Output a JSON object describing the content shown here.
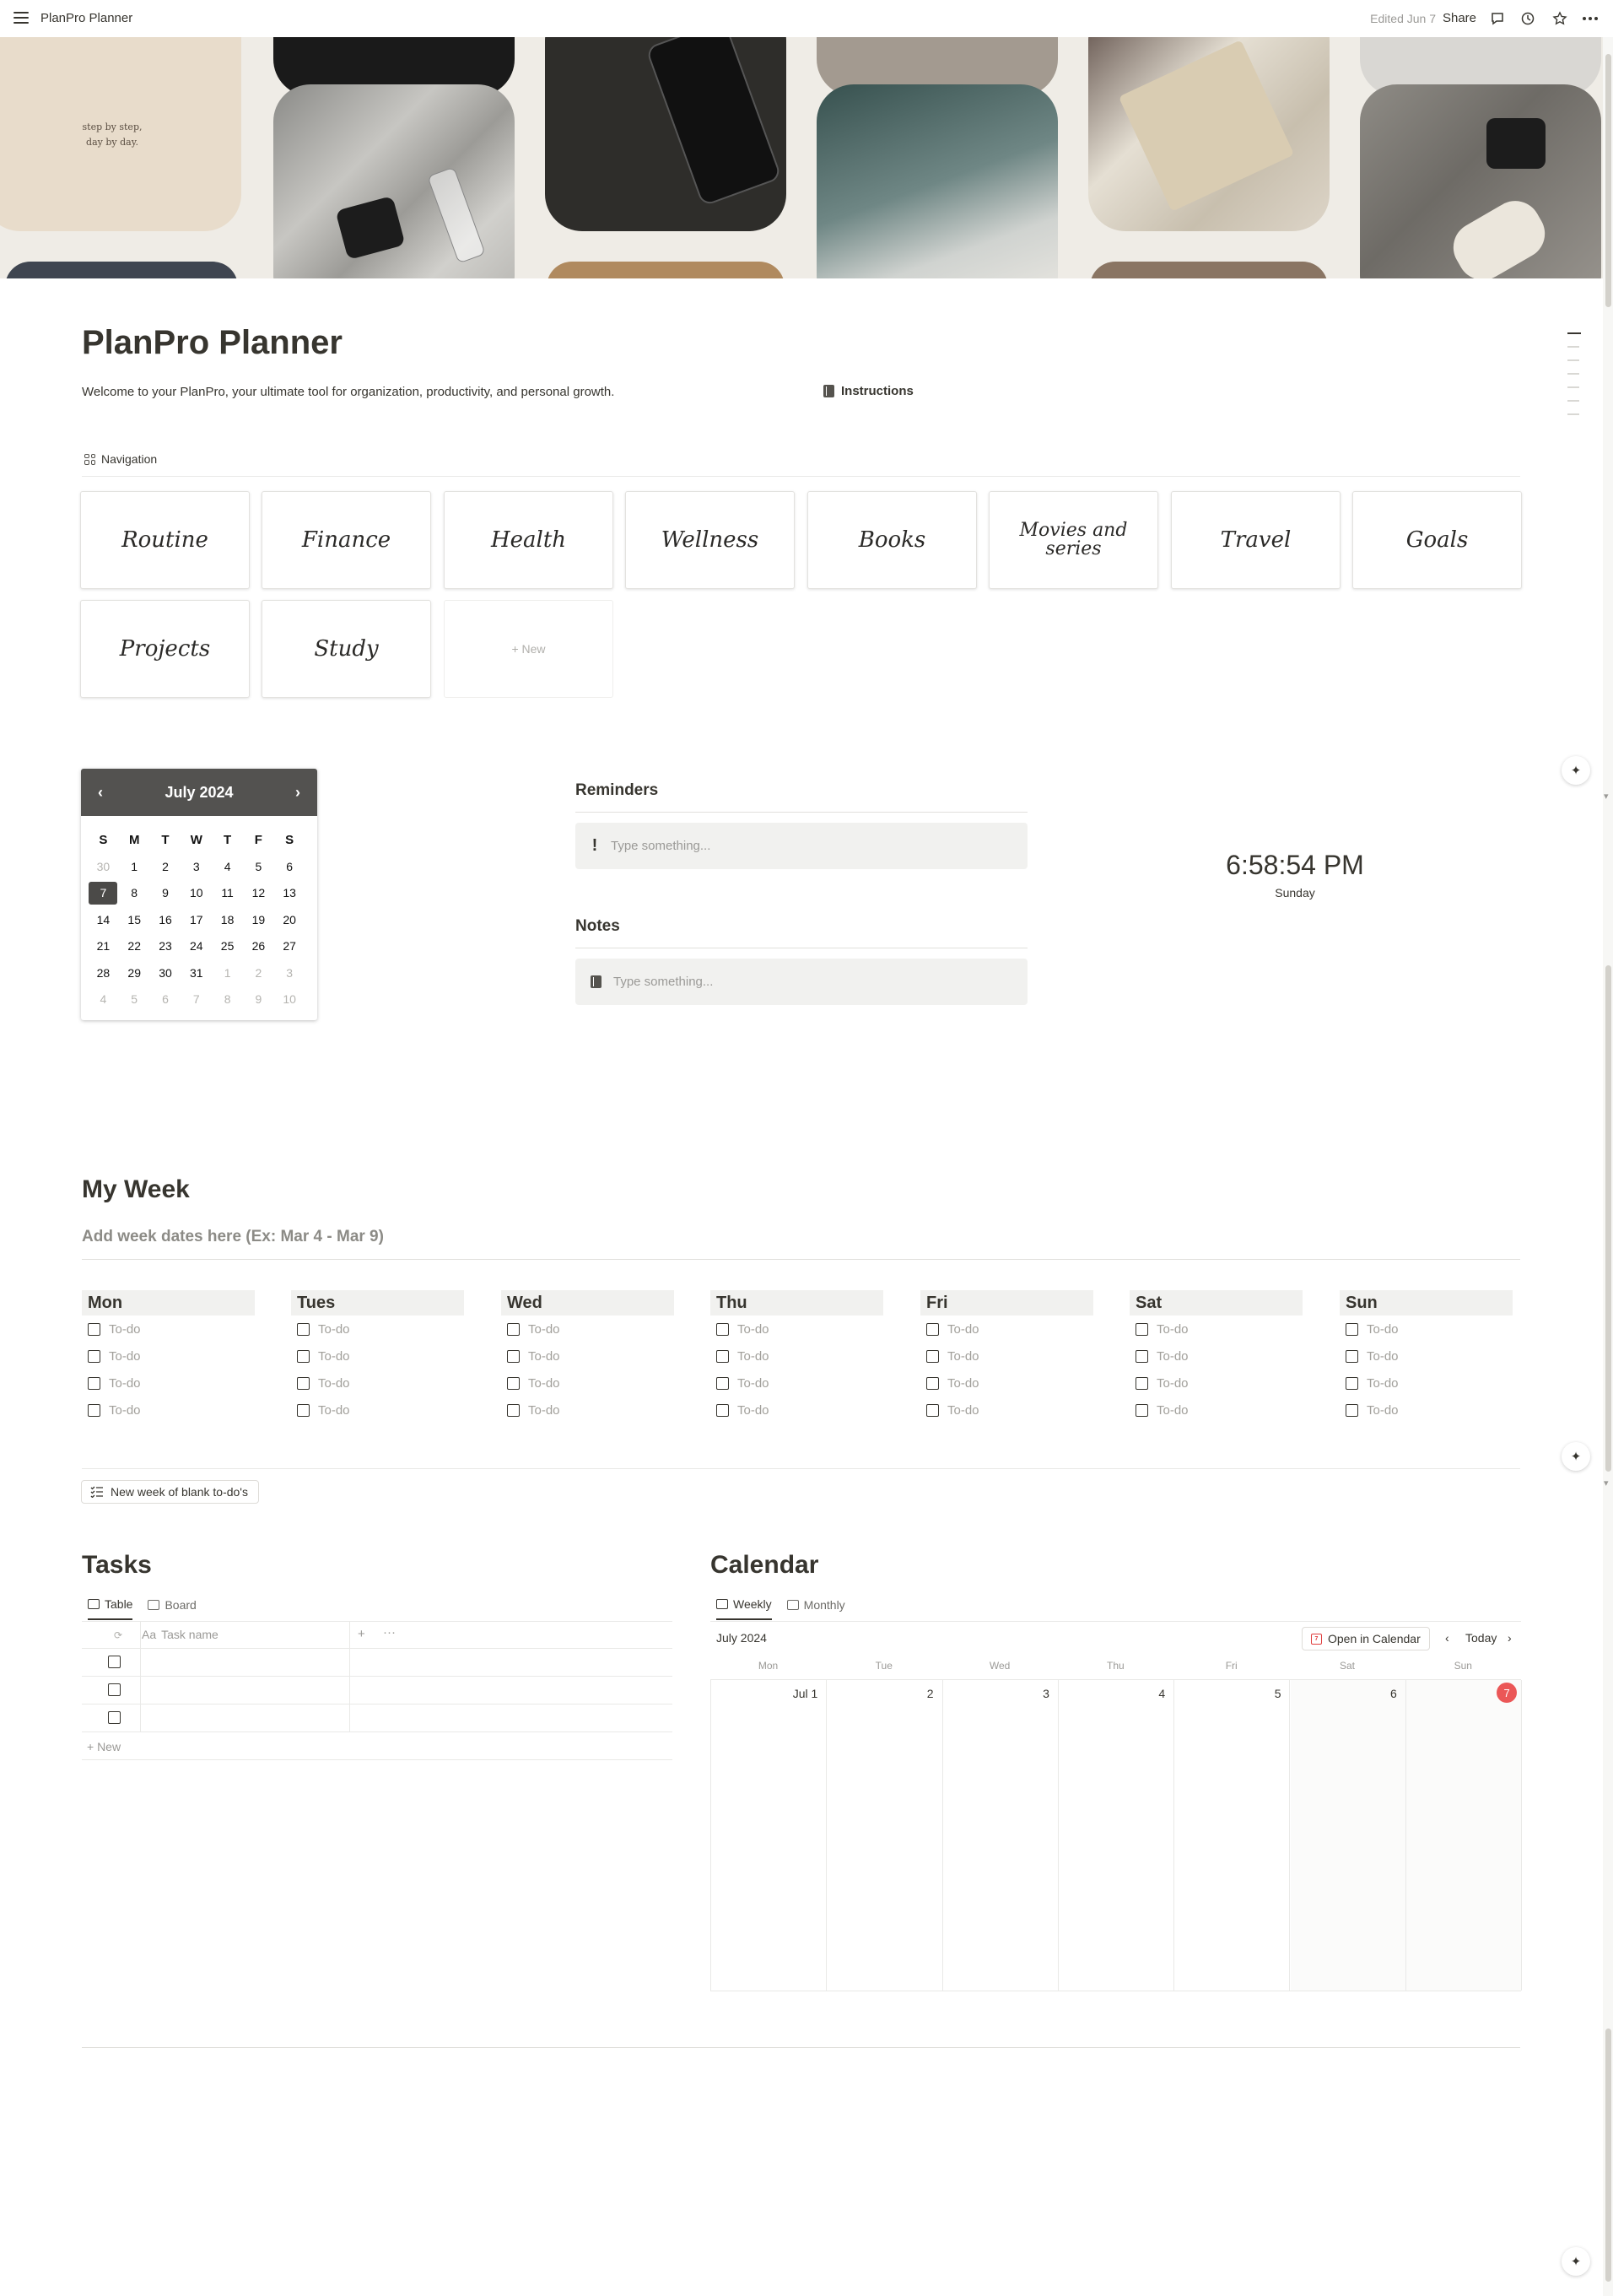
{
  "topbar": {
    "breadcrumb": "PlanPro Planner",
    "edited": "Edited Jun 7",
    "share": "Share"
  },
  "cover": {
    "quote_line1": "step by step,",
    "quote_line2": "day by day."
  },
  "page": {
    "title": "PlanPro Planner",
    "welcome": "Welcome to your PlanPro, your ultimate tool for organization, productivity, and personal growth.",
    "instructions": "Instructions"
  },
  "navigation": {
    "label": "Navigation",
    "cards": [
      "Routine",
      "Finance",
      "Health",
      "Wellness",
      "Books",
      "Movies and series",
      "Travel",
      "Goals",
      "Projects",
      "Study"
    ],
    "new_label": "+ New"
  },
  "mini_calendar": {
    "title": "July 2024",
    "prev": "‹",
    "next": "›",
    "weekdays": [
      "S",
      "M",
      "T",
      "W",
      "T",
      "F",
      "S"
    ],
    "days": [
      "30",
      "1",
      "2",
      "3",
      "4",
      "5",
      "6",
      "7",
      "8",
      "9",
      "10",
      "11",
      "12",
      "13",
      "14",
      "15",
      "16",
      "17",
      "18",
      "19",
      "20",
      "21",
      "22",
      "23",
      "24",
      "25",
      "26",
      "27",
      "28",
      "29",
      "30",
      "31",
      "1",
      "2",
      "3",
      "4",
      "5",
      "6",
      "7",
      "8",
      "9",
      "10"
    ],
    "today_value": "7"
  },
  "reminders": {
    "label": "Reminders",
    "placeholder": "Type something..."
  },
  "notes": {
    "label": "Notes",
    "placeholder": "Type something..."
  },
  "clock": {
    "time": "6:58:54 PM",
    "day": "Sunday"
  },
  "my_week": {
    "title": "My Week",
    "dates_placeholder": "Add week dates here (Ex: Mar 4 - Mar 9)",
    "todo_label": "To-do",
    "days": [
      "Mon",
      "Tues",
      "Wed",
      "Thu",
      "Fri",
      "Sat",
      "Sun"
    ],
    "new_week_button": "New week of blank to-do's"
  },
  "tasks": {
    "title": "Tasks",
    "tabs": [
      "Table",
      "Board"
    ],
    "column_name": "Task name",
    "column_prefix": "Aa",
    "add_column": "+",
    "more": "···",
    "new_row": "+ New"
  },
  "calendar": {
    "title": "Calendar",
    "tabs": [
      "Weekly",
      "Monthly"
    ],
    "month": "July 2024",
    "open_button": "Open in Calendar",
    "today_button": "Today",
    "weekdays": [
      "Mon",
      "Tue",
      "Wed",
      "Thu",
      "Fri",
      "Sat",
      "Sun"
    ],
    "dates": [
      "Jul 1",
      "2",
      "3",
      "4",
      "5",
      "6",
      "7"
    ],
    "today_index": 6,
    "today_color": "#eb5757"
  }
}
